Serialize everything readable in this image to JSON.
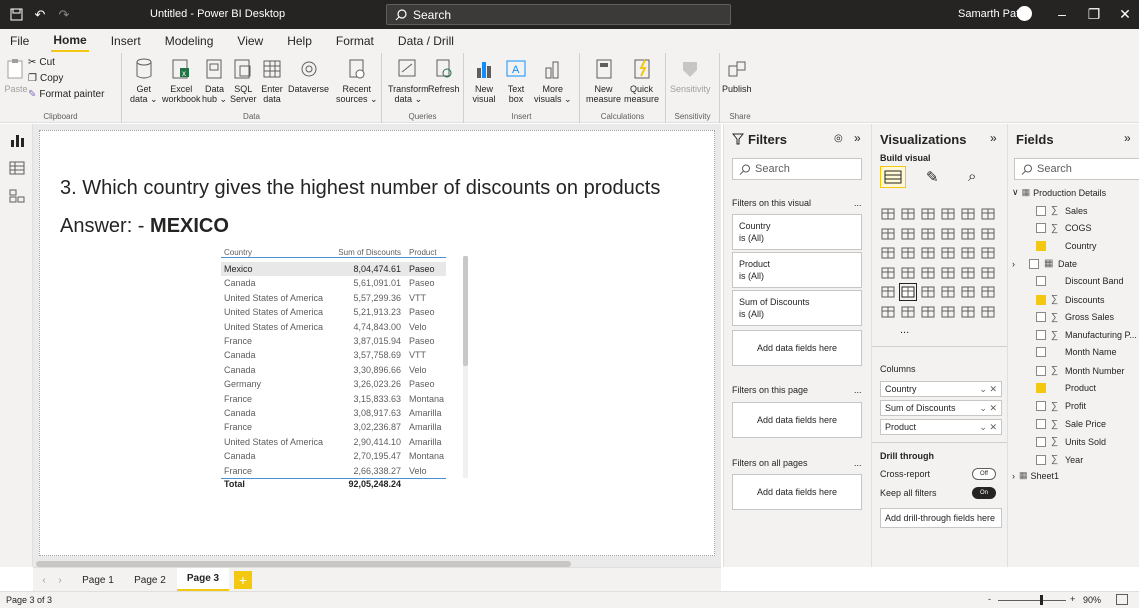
{
  "titlebar": {
    "title": "Untitled - Power BI Desktop",
    "search": "Search",
    "user": "Samarth Patil"
  },
  "menu": [
    "File",
    "Home",
    "Insert",
    "Modeling",
    "View",
    "Help",
    "Format",
    "Data / Drill"
  ],
  "ribbon": {
    "clipboard": {
      "paste": "Paste",
      "cut": "Cut",
      "copy": "Copy",
      "format_painter": "Format painter",
      "label": "Clipboard"
    },
    "data": {
      "get_data": "Get\ndata ⌄",
      "excel": "Excel\nworkbook",
      "data_hub": "Data\nhub ⌄",
      "sql": "SQL\nServer",
      "enter": "Enter\ndata",
      "dataverse": "Dataverse",
      "recent": "Recent\nsources ⌄",
      "label": "Data"
    },
    "queries": {
      "transform": "Transform\ndata ⌄",
      "refresh": "Refresh",
      "label": "Queries"
    },
    "insert": {
      "new_visual": "New\nvisual",
      "text_box": "Text\nbox",
      "more": "More\nvisuals ⌄",
      "label": "Insert"
    },
    "calculations": {
      "new_measure": "New\nmeasure",
      "quick": "Quick\nmeasure",
      "label": "Calculations"
    },
    "sensitivity": {
      "btn": "Sensitivity",
      "label": "Sensitivity"
    },
    "share": {
      "publish": "Publish",
      "label": "Share"
    }
  },
  "canvas": {
    "question": "3. Which country gives the highest number of discounts on products",
    "answer_prefix": "Answer: - ",
    "answer": "MEXICO"
  },
  "table": {
    "headers": [
      "Country",
      "Sum of Discounts",
      "Product"
    ],
    "rows": [
      [
        "Mexico",
        "8,04,474.61",
        "Paseo"
      ],
      [
        "Canada",
        "5,61,091.01",
        "Paseo"
      ],
      [
        "United States of America",
        "5,57,299.36",
        "VTT"
      ],
      [
        "United States of America",
        "5,21,913.23",
        "Paseo"
      ],
      [
        "United States of America",
        "4,74,843.00",
        "Velo"
      ],
      [
        "France",
        "3,87,015.94",
        "Paseo"
      ],
      [
        "Canada",
        "3,57,758.69",
        "VTT"
      ],
      [
        "Canada",
        "3,30,896.66",
        "Velo"
      ],
      [
        "Germany",
        "3,26,023.26",
        "Paseo"
      ],
      [
        "France",
        "3,15,833.63",
        "Montana"
      ],
      [
        "Canada",
        "3,08,917.63",
        "Amarilla"
      ],
      [
        "France",
        "3,02,236.87",
        "Amarilla"
      ],
      [
        "United States of America",
        "2,90,414.10",
        "Amarilla"
      ],
      [
        "Canada",
        "2,70,195.47",
        "Montana"
      ],
      [
        "France",
        "2,66,338.27",
        "Velo"
      ]
    ],
    "total_label": "Total",
    "total_value": "92,05,248.24"
  },
  "filters": {
    "title": "Filters",
    "search": "Search",
    "on_visual": "Filters on this visual",
    "cards": [
      {
        "name": "Country",
        "value": "is (All)"
      },
      {
        "name": "Product",
        "value": "is (All)"
      },
      {
        "name": "Sum of Discounts",
        "value": "is (All)"
      }
    ],
    "add": "Add data fields here",
    "on_page": "Filters on this page",
    "on_all": "Filters on all pages",
    "ellipsis": "..."
  },
  "visualizations": {
    "title": "Visualizations",
    "build": "Build visual",
    "columns_label": "Columns",
    "columns": [
      "Country",
      "Sum of Discounts",
      "Product"
    ],
    "drill_through": "Drill through",
    "cross_report": "Cross-report",
    "cross_report_state": "Off",
    "keep_filters": "Keep all filters",
    "keep_filters_state": "On",
    "add_drill": "Add drill-through fields here",
    "more": "..."
  },
  "fields": {
    "title": "Fields",
    "search": "Search",
    "table": "Production Details",
    "items": [
      {
        "name": "Sales",
        "sigma": true,
        "checked": false
      },
      {
        "name": "COGS",
        "sigma": true,
        "checked": false
      },
      {
        "name": "Country",
        "sigma": false,
        "checked": true
      },
      {
        "name": "Date",
        "sigma": false,
        "checked": false
      },
      {
        "name": "Discount Band",
        "sigma": false,
        "checked": false
      },
      {
        "name": "Discounts",
        "sigma": true,
        "checked": true
      },
      {
        "name": "Gross Sales",
        "sigma": true,
        "checked": false
      },
      {
        "name": "Manufacturing P...",
        "sigma": true,
        "checked": false
      },
      {
        "name": "Month Name",
        "sigma": false,
        "checked": false
      },
      {
        "name": "Month Number",
        "sigma": true,
        "checked": false
      },
      {
        "name": "Product",
        "sigma": false,
        "checked": true
      },
      {
        "name": "Profit",
        "sigma": true,
        "checked": false
      },
      {
        "name": "Sale Price",
        "sigma": true,
        "checked": false
      },
      {
        "name": "Units Sold",
        "sigma": true,
        "checked": false
      },
      {
        "name": "Year",
        "sigma": true,
        "checked": false
      }
    ],
    "sheet": "Sheet1"
  },
  "pages": [
    "Page 1",
    "Page 2",
    "Page 3"
  ],
  "add_page": "+",
  "status": {
    "page": "Page 3 of 3",
    "zoom": "90%",
    "minus": "-",
    "plus": "+"
  },
  "colors": {
    "accent": "#f2c811",
    "titlebar": "#252423"
  }
}
